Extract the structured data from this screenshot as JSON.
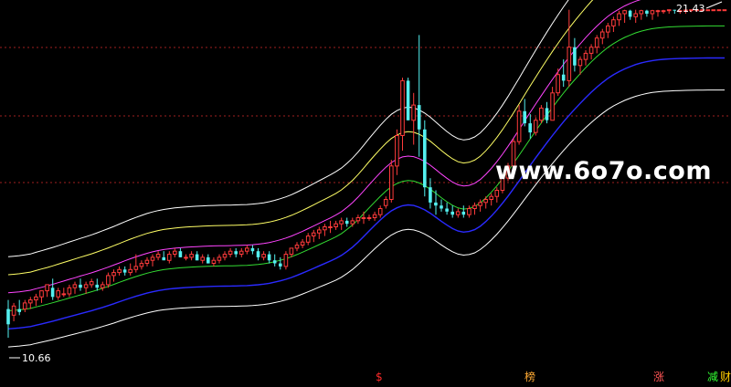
{
  "watermark": "www.6o7o.com",
  "tags": [
    {
      "label": "$",
      "color": "#ff2a2a"
    },
    {
      "label": "榜",
      "color": "#ffaa33"
    },
    {
      "label": "涨",
      "color": "#ff5555"
    },
    {
      "label": "减",
      "color": "#33ff33"
    },
    {
      "label": "财",
      "color": "#ffcc00"
    }
  ],
  "colors": {
    "up": "#ff3b3b",
    "down": "#54f0f0",
    "grid": "#a02020",
    "band_outer": "#ffffff",
    "band_2": "#ffff66",
    "band_3": "#ff44ff",
    "band_mid": "#33dd33",
    "band_5": "#2a2aff"
  },
  "chart_data": {
    "type": "candlestick",
    "y_range": [
      10.66,
      21.43
    ],
    "annotations": {
      "max_label": "21.43",
      "min_label": "10.66"
    },
    "x": [
      0,
      1,
      2,
      3,
      4,
      5,
      6,
      7,
      8,
      9,
      10,
      11,
      12,
      13,
      14,
      15,
      16,
      17,
      18,
      19,
      20,
      21,
      22,
      23,
      24,
      25,
      26,
      27,
      28,
      29,
      30,
      31,
      32,
      33,
      34,
      35,
      36,
      37,
      38,
      39,
      40,
      41,
      42,
      43,
      44,
      45,
      46,
      47,
      48,
      49,
      50,
      51,
      52,
      53,
      54,
      55,
      56,
      57,
      58,
      59,
      60,
      61,
      62,
      63,
      64,
      65,
      66,
      67,
      68,
      69,
      70,
      71,
      72,
      73,
      74,
      75,
      76,
      77,
      78,
      79,
      80,
      81,
      82,
      83,
      84,
      85,
      86,
      87,
      88,
      89,
      90,
      91,
      92,
      93,
      94,
      95,
      96,
      97,
      98,
      99,
      100,
      101,
      102,
      103,
      104,
      105,
      106,
      107,
      108,
      109,
      110,
      111,
      112,
      113,
      114,
      115,
      116,
      117,
      118,
      119,
      120,
      121,
      122,
      123,
      124,
      125,
      126,
      127,
      128,
      129
    ],
    "ohlc": [
      [
        11.6,
        11.9,
        10.66,
        11.1
      ],
      [
        11.4,
        11.8,
        11.2,
        11.7
      ],
      [
        11.6,
        11.9,
        11.4,
        11.5
      ],
      [
        11.6,
        11.9,
        11.5,
        11.8
      ],
      [
        11.8,
        12.0,
        11.6,
        11.9
      ],
      [
        11.9,
        12.1,
        11.7,
        12.0
      ],
      [
        12.0,
        12.2,
        11.8,
        12.2
      ],
      [
        12.2,
        12.4,
        12.0,
        12.4
      ],
      [
        12.3,
        12.6,
        11.9,
        12.0
      ],
      [
        12.0,
        12.3,
        11.9,
        12.2
      ],
      [
        12.1,
        12.3,
        12.0,
        12.1
      ],
      [
        12.1,
        12.4,
        12.0,
        12.3
      ],
      [
        12.3,
        12.5,
        12.1,
        12.4
      ],
      [
        12.4,
        12.6,
        12.2,
        12.3
      ],
      [
        12.3,
        12.5,
        12.1,
        12.4
      ],
      [
        12.4,
        12.6,
        12.3,
        12.5
      ],
      [
        12.4,
        12.6,
        12.2,
        12.3
      ],
      [
        12.3,
        12.5,
        12.2,
        12.4
      ],
      [
        12.4,
        12.8,
        12.3,
        12.7
      ],
      [
        12.7,
        12.9,
        12.5,
        12.8
      ],
      [
        12.8,
        13.0,
        12.7,
        12.9
      ],
      [
        12.9,
        13.0,
        12.7,
        12.8
      ],
      [
        12.8,
        13.1,
        12.7,
        12.9
      ],
      [
        12.9,
        13.4,
        12.8,
        13.0
      ],
      [
        13.0,
        13.2,
        12.9,
        13.1
      ],
      [
        13.1,
        13.3,
        13.0,
        13.2
      ],
      [
        13.2,
        13.4,
        13.0,
        13.3
      ],
      [
        13.3,
        13.5,
        13.2,
        13.4
      ],
      [
        13.3,
        13.5,
        13.2,
        13.2
      ],
      [
        13.2,
        13.5,
        13.1,
        13.4
      ],
      [
        13.4,
        13.6,
        13.3,
        13.5
      ],
      [
        13.5,
        13.6,
        13.3,
        13.3
      ],
      [
        13.3,
        13.4,
        13.2,
        13.3
      ],
      [
        13.3,
        13.5,
        13.2,
        13.4
      ],
      [
        13.4,
        13.5,
        13.2,
        13.2
      ],
      [
        13.2,
        13.4,
        13.1,
        13.3
      ],
      [
        13.3,
        13.4,
        13.1,
        13.1
      ],
      [
        13.1,
        13.3,
        13.0,
        13.2
      ],
      [
        13.2,
        13.4,
        13.1,
        13.3
      ],
      [
        13.3,
        13.5,
        13.2,
        13.4
      ],
      [
        13.4,
        13.6,
        13.3,
        13.5
      ],
      [
        13.5,
        13.6,
        13.3,
        13.4
      ],
      [
        13.4,
        13.6,
        13.3,
        13.5
      ],
      [
        13.5,
        13.7,
        13.4,
        13.6
      ],
      [
        13.6,
        13.7,
        13.4,
        13.5
      ],
      [
        13.5,
        13.6,
        13.2,
        13.3
      ],
      [
        13.3,
        13.5,
        13.2,
        13.4
      ],
      [
        13.4,
        13.5,
        13.1,
        13.2
      ],
      [
        13.2,
        13.4,
        13.0,
        13.1
      ],
      [
        13.1,
        13.3,
        12.9,
        13.0
      ],
      [
        13.0,
        13.5,
        12.9,
        13.4
      ],
      [
        13.4,
        13.6,
        13.3,
        13.6
      ],
      [
        13.6,
        13.8,
        13.5,
        13.7
      ],
      [
        13.7,
        13.9,
        13.6,
        13.8
      ],
      [
        13.8,
        14.1,
        13.7,
        14.0
      ],
      [
        14.0,
        14.2,
        13.8,
        14.1
      ],
      [
        14.1,
        14.3,
        13.9,
        14.2
      ],
      [
        14.2,
        14.4,
        14.0,
        14.3
      ],
      [
        14.3,
        14.5,
        14.1,
        14.3
      ],
      [
        14.3,
        14.5,
        14.2,
        14.4
      ],
      [
        14.4,
        14.6,
        14.2,
        14.5
      ],
      [
        14.5,
        14.6,
        14.3,
        14.4
      ],
      [
        14.4,
        14.6,
        14.3,
        14.5
      ],
      [
        14.5,
        14.7,
        14.4,
        14.6
      ],
      [
        14.6,
        14.8,
        14.4,
        14.6
      ],
      [
        14.6,
        14.7,
        14.5,
        14.6
      ],
      [
        14.6,
        14.8,
        14.5,
        14.7
      ],
      [
        14.7,
        15.0,
        14.6,
        14.9
      ],
      [
        15.0,
        15.3,
        14.9,
        15.2
      ],
      [
        15.2,
        16.5,
        15.1,
        16.3
      ],
      [
        16.3,
        17.5,
        16.0,
        17.3
      ],
      [
        17.3,
        19.2,
        16.8,
        19.1
      ],
      [
        19.1,
        19.2,
        17.8,
        17.8
      ],
      [
        17.8,
        18.7,
        17.0,
        18.3
      ],
      [
        18.3,
        20.6,
        16.6,
        17.5
      ],
      [
        17.5,
        17.8,
        15.3,
        15.6
      ],
      [
        15.6,
        15.9,
        14.9,
        15.1
      ],
      [
        15.1,
        15.5,
        14.7,
        15.0
      ],
      [
        15.0,
        15.2,
        14.8,
        14.9
      ],
      [
        14.9,
        15.1,
        14.7,
        14.8
      ],
      [
        14.8,
        15.0,
        14.6,
        14.7
      ],
      [
        14.7,
        14.9,
        14.6,
        14.8
      ],
      [
        14.8,
        15.0,
        14.6,
        14.7
      ],
      [
        14.7,
        15.0,
        14.6,
        14.9
      ],
      [
        14.9,
        15.1,
        14.7,
        15.0
      ],
      [
        15.0,
        15.2,
        14.8,
        15.1
      ],
      [
        15.1,
        15.3,
        14.9,
        15.2
      ],
      [
        15.2,
        15.4,
        15.0,
        15.3
      ],
      [
        15.3,
        15.6,
        15.1,
        15.5
      ],
      [
        15.5,
        16.0,
        15.4,
        15.9
      ],
      [
        15.9,
        16.4,
        15.8,
        16.3
      ],
      [
        16.3,
        17.2,
        16.2,
        17.1
      ],
      [
        17.1,
        18.3,
        17.0,
        18.1
      ],
      [
        18.1,
        18.5,
        17.6,
        17.7
      ],
      [
        17.7,
        18.0,
        17.2,
        17.4
      ],
      [
        17.4,
        17.9,
        17.3,
        17.8
      ],
      [
        17.8,
        18.3,
        17.7,
        18.2
      ],
      [
        18.2,
        18.4,
        17.7,
        17.8
      ],
      [
        17.8,
        18.9,
        17.8,
        18.7
      ],
      [
        18.7,
        19.5,
        18.6,
        19.3
      ],
      [
        19.3,
        19.8,
        18.9,
        19.1
      ],
      [
        19.1,
        21.43,
        18.9,
        20.2
      ],
      [
        20.2,
        20.5,
        19.4,
        19.6
      ],
      [
        19.6,
        19.9,
        19.3,
        19.8
      ],
      [
        19.8,
        20.1,
        19.6,
        20.0
      ],
      [
        20.0,
        20.3,
        19.8,
        20.2
      ],
      [
        20.2,
        20.6,
        20.0,
        20.5
      ],
      [
        20.5,
        20.8,
        20.3,
        20.7
      ],
      [
        20.7,
        21.0,
        20.5,
        20.9
      ],
      [
        20.9,
        21.2,
        20.7,
        21.1
      ],
      [
        21.1,
        21.4,
        20.9,
        21.3
      ],
      [
        21.3,
        21.43,
        21.0,
        21.4
      ],
      [
        21.4,
        21.43,
        21.1,
        21.2
      ],
      [
        21.2,
        21.43,
        21.0,
        21.3
      ],
      [
        21.3,
        21.43,
        21.1,
        21.4
      ],
      [
        21.4,
        21.43,
        21.2,
        21.3
      ],
      [
        21.3,
        21.43,
        21.1,
        21.4
      ],
      [
        21.4,
        21.43,
        21.2,
        21.4
      ],
      [
        21.4,
        21.43,
        21.3,
        21.4
      ],
      [
        21.4,
        21.43,
        21.3,
        21.43
      ],
      [
        21.43,
        21.43,
        21.3,
        21.4
      ],
      [
        21.4,
        21.43,
        21.3,
        21.4
      ],
      [
        21.4,
        21.43,
        21.3,
        21.42
      ],
      [
        21.42,
        21.43,
        21.35,
        21.43
      ],
      [
        21.43,
        21.43,
        21.38,
        21.43
      ],
      [
        21.43,
        21.43,
        21.4,
        21.43
      ],
      [
        21.43,
        21.43,
        21.4,
        21.43
      ],
      [
        21.43,
        21.43,
        21.4,
        21.43
      ],
      [
        21.43,
        21.43,
        21.4,
        21.43
      ],
      [
        21.43,
        21.43,
        21.4,
        21.43
      ]
    ],
    "bands": {
      "offsets": [
        1.5,
        0.9,
        0.3,
        -0.3,
        -0.9,
        -1.5
      ],
      "colors": [
        "#ffffff",
        "#ffff66",
        "#ff44ff",
        "#33dd33",
        "#2a2aff",
        "#ffffff"
      ]
    }
  }
}
